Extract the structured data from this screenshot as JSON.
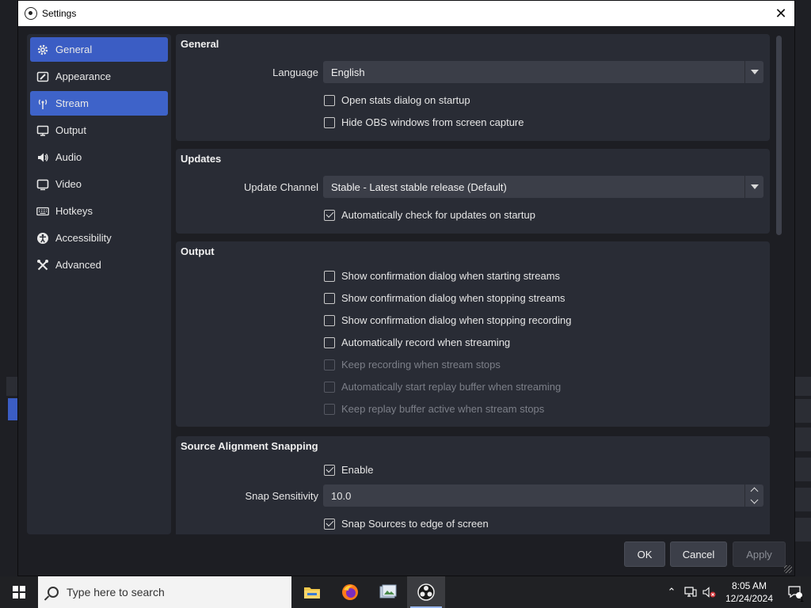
{
  "dialog": {
    "title": "Settings"
  },
  "sidebar": {
    "items": [
      {
        "label": "General",
        "icon": "gear-icon",
        "state": "active"
      },
      {
        "label": "Appearance",
        "icon": "appearance-icon",
        "state": ""
      },
      {
        "label": "Stream",
        "icon": "antenna-icon",
        "state": "hover"
      },
      {
        "label": "Output",
        "icon": "monitor-output-icon",
        "state": ""
      },
      {
        "label": "Audio",
        "icon": "speaker-icon",
        "state": ""
      },
      {
        "label": "Video",
        "icon": "screen-icon",
        "state": ""
      },
      {
        "label": "Hotkeys",
        "icon": "keyboard-icon",
        "state": ""
      },
      {
        "label": "Accessibility",
        "icon": "accessibility-icon",
        "state": ""
      },
      {
        "label": "Advanced",
        "icon": "tools-icon",
        "state": ""
      }
    ]
  },
  "general": {
    "title": "General",
    "language_label": "Language",
    "language_value": "English",
    "open_stats": {
      "label": "Open stats dialog on startup",
      "checked": false
    },
    "hide_obs": {
      "label": "Hide OBS windows from screen capture",
      "checked": false
    }
  },
  "updates": {
    "title": "Updates",
    "channel_label": "Update Channel",
    "channel_value": "Stable - Latest stable release (Default)",
    "auto_check": {
      "label": "Automatically check for updates on startup",
      "checked": true
    }
  },
  "output": {
    "title": "Output",
    "options": [
      {
        "label": "Show confirmation dialog when starting streams",
        "checked": false,
        "enabled": true
      },
      {
        "label": "Show confirmation dialog when stopping streams",
        "checked": false,
        "enabled": true
      },
      {
        "label": "Show confirmation dialog when stopping recording",
        "checked": false,
        "enabled": true
      },
      {
        "label": "Automatically record when streaming",
        "checked": false,
        "enabled": true
      },
      {
        "label": "Keep recording when stream stops",
        "checked": false,
        "enabled": false
      },
      {
        "label": "Automatically start replay buffer when streaming",
        "checked": false,
        "enabled": false
      },
      {
        "label": "Keep replay buffer active when stream stops",
        "checked": false,
        "enabled": false
      }
    ]
  },
  "snapping": {
    "title": "Source Alignment Snapping",
    "enable": {
      "label": "Enable",
      "checked": true
    },
    "sensitivity_label": "Snap Sensitivity",
    "sensitivity_value": "10.0",
    "snap_edge": {
      "label": "Snap Sources to edge of screen",
      "checked": true
    }
  },
  "buttons": {
    "ok": "OK",
    "cancel": "Cancel",
    "apply": "Apply"
  },
  "taskbar": {
    "search_placeholder": "Type here to search",
    "time": "8:05 AM",
    "date": "12/24/2024",
    "notification_count": "1"
  },
  "colors": {
    "accent": "#3b5dc4",
    "panel": "#292c35",
    "background": "#1d1e23"
  }
}
